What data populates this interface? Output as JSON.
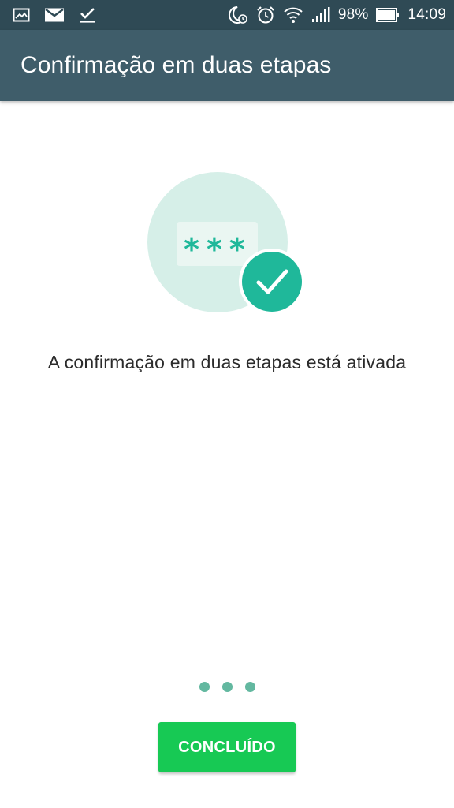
{
  "status_bar": {
    "left_icons": [
      "image-icon",
      "mail-icon",
      "checkmark-download-icon"
    ],
    "right_icons": [
      "moon-clock-icon",
      "alarm-icon",
      "wifi-icon",
      "signal-icon",
      "battery-icon"
    ],
    "battery": "98%",
    "time": "14:09"
  },
  "app_bar": {
    "title": "Confirmação em duas etapas"
  },
  "illustration": {
    "password_mask": "***",
    "icon": "check-circle-icon",
    "colors": {
      "circle_bg": "#d6efe8",
      "card_bg": "#eaf6f2",
      "accent": "#1fb89a"
    }
  },
  "main": {
    "message": "A confirmação em duas etapas está ativada",
    "page_indicator": {
      "count": 3,
      "color": "#63b8a0"
    },
    "done_button": "CONCLUÍDO"
  },
  "colors": {
    "status_bar": "#2f4a55",
    "app_bar": "#3f5d6a",
    "button": "#17c954"
  }
}
